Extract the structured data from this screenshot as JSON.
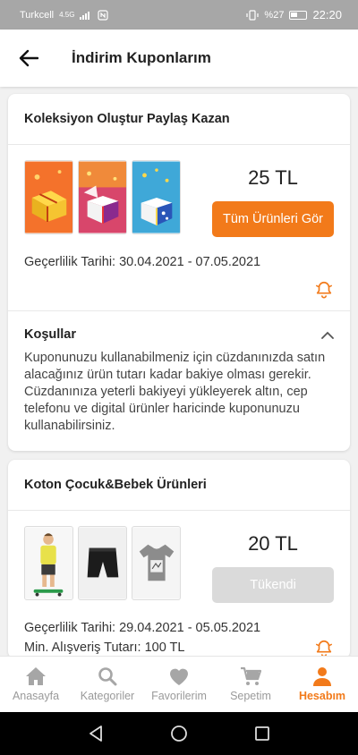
{
  "status": {
    "carrier": "Turkcell",
    "network": "4.5G",
    "battery": "%27",
    "time": "22:20"
  },
  "header": {
    "title": "İndirim Kuponlarım",
    "back_icon": "arrow-left-icon"
  },
  "coupons": [
    {
      "title": "Koleksiyon Oluştur Paylaş Kazan",
      "amount": "25 TL",
      "button_label": "Tüm Ürünleri Gör",
      "button_state": "active",
      "validity": "Geçerlilik Tarihi: 30.04.2021 - 07.05.2021",
      "conditions_title": "Koşullar",
      "conditions_text": "Kuponunuzu kullanabilmeniz için cüzdanınızda satın alacağınız ürün tutarı kadar bakiye olması gerekir. Cüzdanınıza yeterli bakiyeyi yükleyerek altın, cep telefonu ve digital ürünler haricinde kuponunuzu kullanabilirsiniz."
    },
    {
      "title": "Koton Çocuk&Bebek Ürünleri",
      "amount": "20 TL",
      "button_label": "Tükendi",
      "button_state": "disabled",
      "validity": "Geçerlilik Tarihi: 29.04.2021 - 05.05.2021",
      "min_amount": "Min. Alışveriş Tutarı: 100 TL"
    }
  ],
  "bottom_nav": [
    {
      "label": "Anasayfa",
      "icon": "home-icon"
    },
    {
      "label": "Kategoriler",
      "icon": "search-icon"
    },
    {
      "label": "Favorilerim",
      "icon": "heart-icon"
    },
    {
      "label": "Sepetim",
      "icon": "cart-icon"
    },
    {
      "label": "Hesabım",
      "icon": "user-icon",
      "active": true
    }
  ],
  "colors": {
    "accent": "#f27a1a",
    "disabled": "#dadada"
  }
}
